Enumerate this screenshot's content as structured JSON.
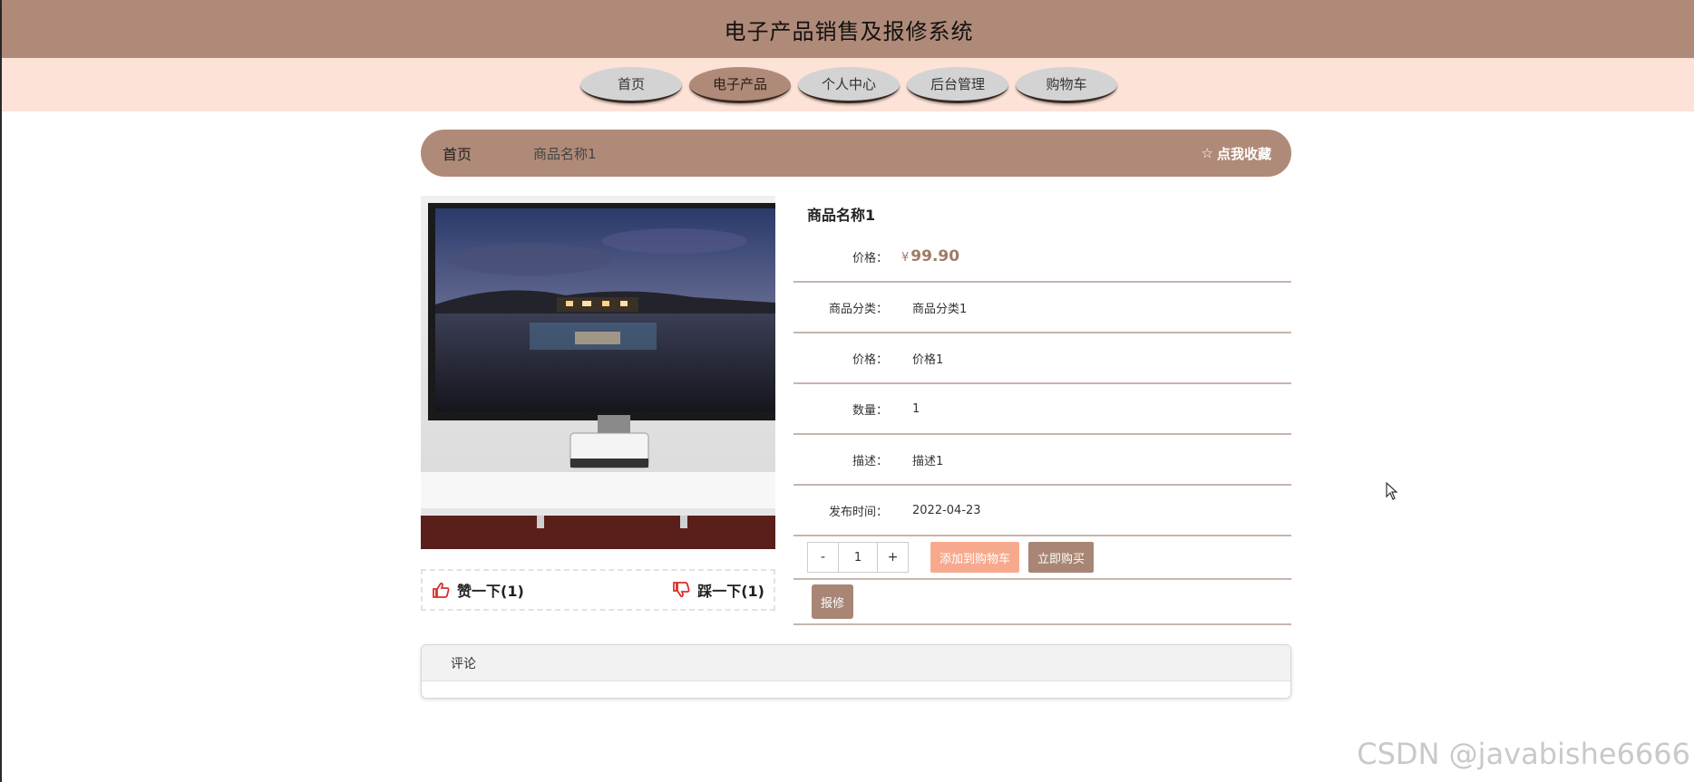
{
  "app": {
    "title": "电子产品销售及报修系统"
  },
  "nav": {
    "items": [
      {
        "label": "首页",
        "active": false
      },
      {
        "label": "电子产品",
        "active": true
      },
      {
        "label": "个人中心",
        "active": false
      },
      {
        "label": "后台管理",
        "active": false
      },
      {
        "label": "购物车",
        "active": false
      }
    ]
  },
  "breadcrumb": {
    "home": "首页",
    "current": "商品名称1",
    "favorite": "点我收藏"
  },
  "product": {
    "name": "商品名称1",
    "price_label": "价格：",
    "price_symbol": "¥",
    "price_value": "99.90",
    "details": [
      {
        "label": "商品分类：",
        "value": "商品分类1"
      },
      {
        "label": "价格：",
        "value": "价格1"
      },
      {
        "label": "数量：",
        "value": "1"
      },
      {
        "label": "描述：",
        "value": "描述1"
      },
      {
        "label": "发布时间：",
        "value": "2022-04-23"
      }
    ]
  },
  "actions": {
    "minus": "-",
    "quantity": "1",
    "plus": "+",
    "add_to_cart": "添加到购物车",
    "buy_now": "立即购买",
    "repair": "报修"
  },
  "votes": {
    "like": "赞一下(1)",
    "dislike": "踩一下(1)"
  },
  "comments": {
    "title": "评论"
  },
  "watermark": "CSDN @javabishe6666",
  "colors": {
    "header": "#b08a78",
    "nav_bg": "#fde2d8",
    "accent": "#a88574",
    "cart": "#f7a98d"
  }
}
